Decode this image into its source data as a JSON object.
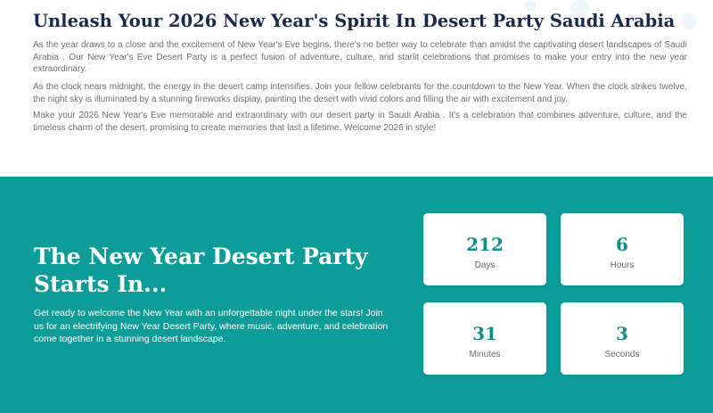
{
  "intro": {
    "title": "Unleash Your 2026 New Year's Spirit In Desert Party Saudi Arabia",
    "paragraphs": [
      "As the year draws to a close and the excitement of New Year's Eve begins, there's no better way to celebrate than amidst the captivating desert landscapes of Saudi Arabia . Our New Year's Eve Desert Party is a perfect fusion of adventure, culture, and starlit celebrations that promises to make your entry into the new year extraordinary.",
      "As the clock nears midnight, the energy in the desert camp intensifies. Join your fellow celebrants for the countdown to the New Year. When the clock strikes twelve, the night sky is illuminated by a stunning fireworks display, painting the desert with vivid colors and filling the air with excitement and joy.",
      "Make your 2026 New Year's Eve memorable and extraordinary with our desert party in Saudi Arabia . It's a celebration that combines adventure, culture, and the timeless charm of the desert, promising to create memories that last a lifetime. Welcome 2026 in style!"
    ]
  },
  "countdown_section": {
    "title": "The New Year Desert Party Starts In...",
    "description": "Get ready to welcome the New Year with an unforgettable night under the stars! Join us for an electrifying New Year Desert Party, where music, adventure, and celebration come together in a stunning desert landscape.",
    "cards": [
      {
        "value": "212",
        "label": "Days"
      },
      {
        "value": "6",
        "label": "Hours"
      },
      {
        "value": "31",
        "label": "Minutes"
      },
      {
        "value": "3",
        "label": "Seconds"
      }
    ]
  },
  "colors": {
    "accent": "#0d9c97",
    "heading": "#1c2a4a",
    "body_text": "#6f6f6f",
    "countdown_number": "#0d8f8a"
  }
}
